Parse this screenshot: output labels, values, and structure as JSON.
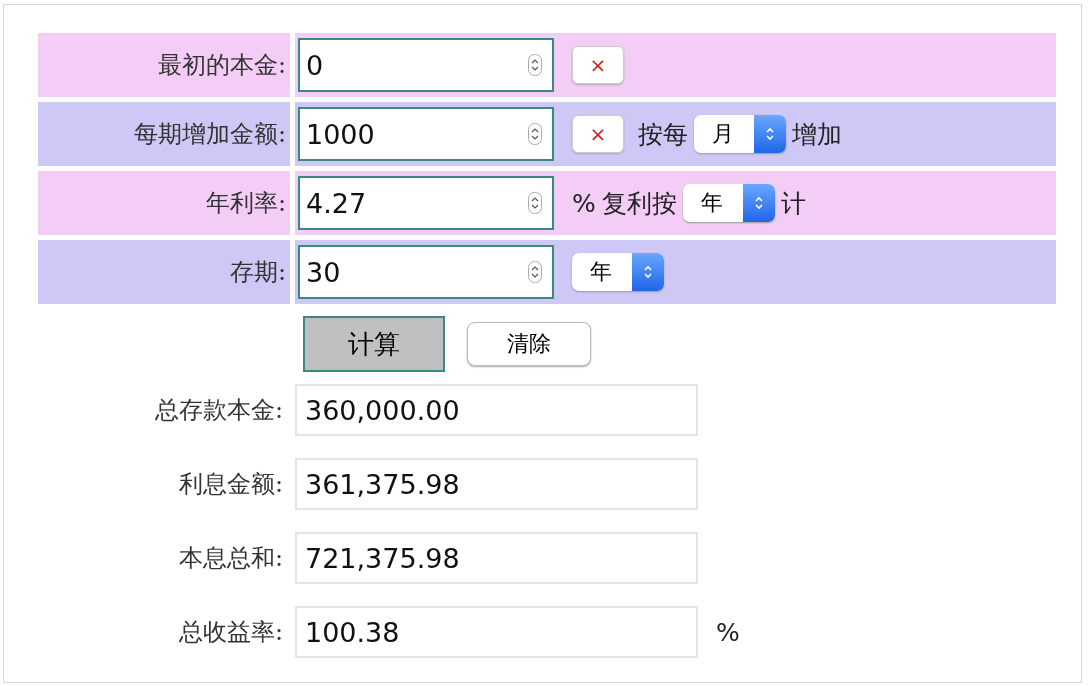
{
  "inputs": [
    {
      "label": "最初的本金:",
      "value": "0",
      "extras": [
        {
          "kind": "clear-button",
          "text": "×"
        }
      ]
    },
    {
      "label": "每期增加金额:",
      "value": "1000",
      "extras": [
        {
          "kind": "clear-button",
          "text": "×"
        },
        {
          "kind": "text",
          "text": "按每"
        },
        {
          "kind": "select",
          "value": "月"
        },
        {
          "kind": "text",
          "text": "增加"
        }
      ]
    },
    {
      "label": "年利率:",
      "value": "4.27",
      "extras": [
        {
          "kind": "text",
          "text": "%"
        },
        {
          "kind": "text",
          "text": "复利按"
        },
        {
          "kind": "select",
          "value": "年"
        },
        {
          "kind": "text",
          "text": "计"
        }
      ]
    },
    {
      "label": "存期:",
      "value": "30",
      "extras": [
        {
          "kind": "select",
          "value": "年"
        }
      ]
    }
  ],
  "buttons": [
    {
      "label": "计算",
      "focused": true
    },
    {
      "label": "清除",
      "focused": false
    }
  ],
  "results": [
    {
      "label": "总存款本金:",
      "value": "360,000.00"
    },
    {
      "label": "利息金额:",
      "value": "361,375.98"
    },
    {
      "label": "本息总和:",
      "value": "721,375.98"
    },
    {
      "label": "总收益率:",
      "value": "100.38",
      "unit": "%"
    }
  ]
}
